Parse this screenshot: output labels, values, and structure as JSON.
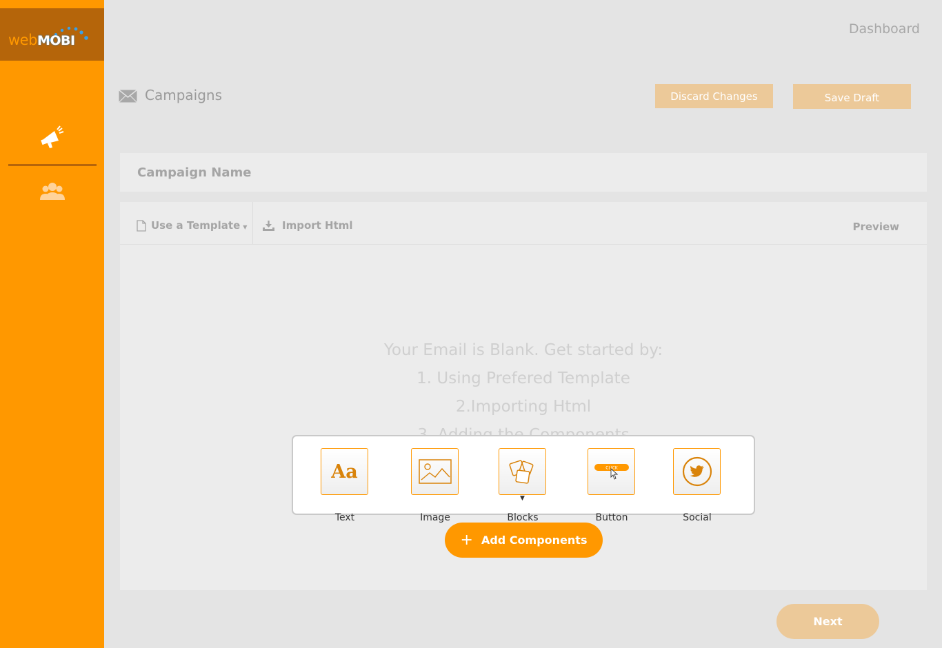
{
  "brand": {
    "logo_web": "web",
    "logo_mobi": "MOBI",
    "accent": "#ff9800",
    "accent_dark": "#b5650a"
  },
  "sidebar": {
    "items": [
      {
        "icon": "megaphone-icon",
        "active": true
      },
      {
        "icon": "users-icon",
        "active": false
      }
    ]
  },
  "header": {
    "dashboard_link": "Dashboard"
  },
  "page": {
    "title": "Campaigns",
    "title_icon": "envelope-icon",
    "discard_label": "Discard Changes",
    "save_label": "Save Draft"
  },
  "campaign": {
    "name_placeholder": "Campaign Name"
  },
  "toolbar": {
    "template_label": "Use a Template",
    "import_label": "Import Html",
    "preview_label": "Preview"
  },
  "empty_state": {
    "line1": "Your Email is Blank. Get started by:",
    "line2": "1. Using Prefered Template",
    "line3": "2.Importing Html",
    "line4": "3. Adding the Components"
  },
  "components": [
    {
      "label": "Text",
      "icon": "text-aa-icon"
    },
    {
      "label": "Image",
      "icon": "image-icon"
    },
    {
      "label": "Blocks",
      "icon": "blocks-icon"
    },
    {
      "label": "Button",
      "icon": "button-click-icon"
    },
    {
      "label": "Social",
      "icon": "twitter-icon"
    }
  ],
  "actions": {
    "add_components": "Add Components",
    "next": "Next"
  }
}
